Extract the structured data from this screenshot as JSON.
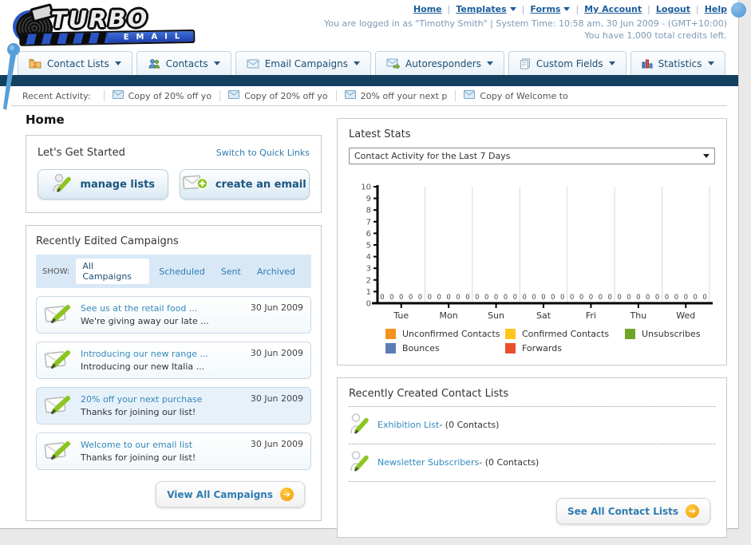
{
  "header": {
    "logo": {
      "title": "TURBO",
      "subtitle": "EMAIL"
    },
    "nav_links": [
      {
        "label": "Home",
        "dropdown": false
      },
      {
        "label": "Templates",
        "dropdown": true
      },
      {
        "label": "Forms",
        "dropdown": true
      },
      {
        "label": "My Account",
        "dropdown": false
      },
      {
        "label": "Logout",
        "dropdown": false
      },
      {
        "label": "Help",
        "dropdown": false
      }
    ],
    "login_status": "You are logged in as \"Timothy Smith\" | System Time: 10:58 am, 30 Jun 2009 - (GMT+10:00)",
    "credits": "You have 1,000 total credits left."
  },
  "tabs": [
    {
      "label": "Contact Lists"
    },
    {
      "label": "Contacts"
    },
    {
      "label": "Email Campaigns"
    },
    {
      "label": "Autoresponders"
    },
    {
      "label": "Custom Fields"
    },
    {
      "label": "Statistics"
    }
  ],
  "recent_activity": {
    "label": "Recent Activity:",
    "items": [
      "Copy of 20% off yo",
      "Copy of 20% off yo",
      "20% off your next p",
      "Copy of Welcome to"
    ]
  },
  "page_title": "Home",
  "get_started": {
    "title": "Let's Get Started",
    "switch_link": "Switch to Quick Links",
    "manage_lists_label": "manage lists",
    "create_email_label": "create an email"
  },
  "campaigns": {
    "title": "Recently Edited Campaigns",
    "show_label": "SHOW:",
    "filters": [
      "All Campaigns",
      "Scheduled",
      "Sent",
      "Archived"
    ],
    "active_filter": "All Campaigns",
    "items": [
      {
        "title": "See us at the retail food ...",
        "subtitle": "We're giving away our late ...",
        "date": "30 Jun 2009"
      },
      {
        "title": "Introducing our new range ...",
        "subtitle": "Introducing our new Italia ...",
        "date": "30 Jun 2009"
      },
      {
        "title": "20% off your next purchase",
        "subtitle": "Thanks for joining our list!",
        "date": "30 Jun 2009"
      },
      {
        "title": "Welcome to our email list",
        "subtitle": "Thanks for joining our list!",
        "date": "30 Jun 2009"
      }
    ],
    "view_all_label": "View All Campaigns"
  },
  "latest_stats": {
    "title": "Latest Stats",
    "selected_option": "Contact Activity for the Last 7 Days"
  },
  "chart_data": {
    "type": "bar",
    "title": "Contact Activity for the Last 7 Days",
    "categories": [
      "Tue",
      "Mon",
      "Sun",
      "Sat",
      "Fri",
      "Thu",
      "Wed"
    ],
    "series": [
      {
        "name": "Unconfirmed Contacts",
        "color": "#f6911e",
        "values": [
          0,
          0,
          0,
          0,
          0,
          0,
          0
        ]
      },
      {
        "name": "Confirmed Contacts",
        "color": "#fdc61c",
        "values": [
          0,
          0,
          0,
          0,
          0,
          0,
          0
        ]
      },
      {
        "name": "Unsubscribes",
        "color": "#70a424",
        "values": [
          0,
          0,
          0,
          0,
          0,
          0,
          0
        ]
      },
      {
        "name": "Bounces",
        "color": "#5d7cb5",
        "values": [
          0,
          0,
          0,
          0,
          0,
          0,
          0
        ]
      },
      {
        "name": "Forwards",
        "color": "#e8512b",
        "values": [
          0,
          0,
          0,
          0,
          0,
          0,
          0
        ]
      }
    ],
    "xlabel": "",
    "ylabel": "",
    "ylim": [
      0,
      10
    ],
    "ytick_step": 1,
    "grid": true,
    "legend_position": "bottom",
    "zero_labels_shown": true
  },
  "contact_lists": {
    "title": "Recently Created Contact Lists",
    "items": [
      {
        "name": "Exhibition List",
        "detail": " - (0 Contacts)"
      },
      {
        "name": "Newsletter Subscribers",
        "detail": " - (0 Contacts)"
      }
    ],
    "see_all_label": "See All Contact Lists"
  }
}
